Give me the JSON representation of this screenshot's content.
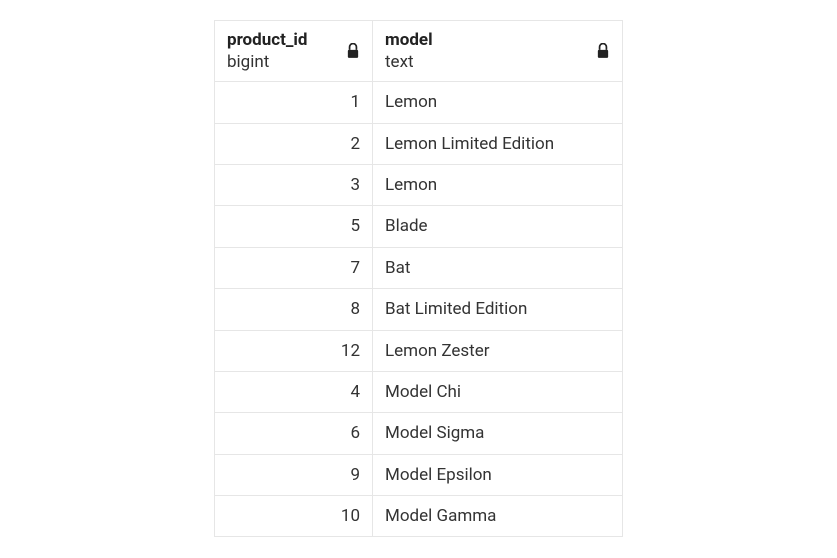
{
  "columns": [
    {
      "name": "product_id",
      "type": "bigint",
      "locked": true
    },
    {
      "name": "model",
      "type": "text",
      "locked": true
    }
  ],
  "rows": [
    {
      "product_id": "1",
      "model": "Lemon"
    },
    {
      "product_id": "2",
      "model": "Lemon Limited Edition"
    },
    {
      "product_id": "3",
      "model": "Lemon"
    },
    {
      "product_id": "5",
      "model": "Blade"
    },
    {
      "product_id": "7",
      "model": "Bat"
    },
    {
      "product_id": "8",
      "model": "Bat Limited Edition"
    },
    {
      "product_id": "12",
      "model": "Lemon Zester"
    },
    {
      "product_id": "4",
      "model": "Model Chi"
    },
    {
      "product_id": "6",
      "model": "Model Sigma"
    },
    {
      "product_id": "9",
      "model": "Model Epsilon"
    },
    {
      "product_id": "10",
      "model": "Model Gamma"
    }
  ]
}
